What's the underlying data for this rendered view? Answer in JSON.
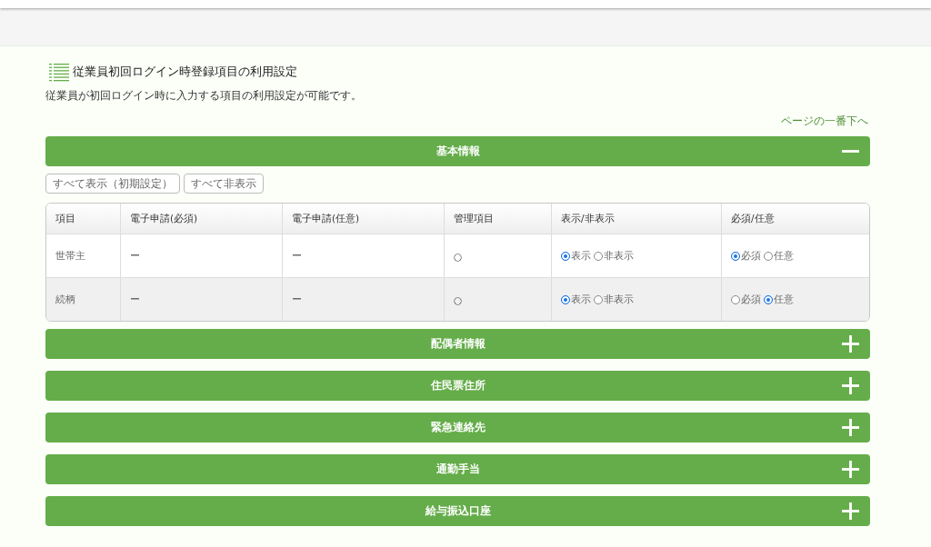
{
  "page": {
    "title": "従業員初回ログイン時登録項目の利用設定",
    "description": "従業員が初回ログイン時に入力する項目の利用設定が可能です。",
    "jump_link": "ページの一番下へ"
  },
  "sections": [
    {
      "title": "基本情報",
      "expanded": true,
      "buttons": [
        "すべて表示（初期設定）",
        "すべて非表示"
      ],
      "table": {
        "columns": [
          "項目",
          "電子申請(必須)",
          "電子申請(任意)",
          "管理項目",
          "表示/非表示",
          "必須/任意"
        ],
        "rows": [
          {
            "item": "世帯主",
            "required_app": "ー",
            "optional_app": "ー",
            "managed": "○",
            "display": [
              {
                "label": "表示",
                "selected": true
              },
              {
                "label": "非表示",
                "selected": false
              }
            ],
            "requirement": [
              {
                "label": "必須",
                "selected": true
              },
              {
                "label": "任意",
                "selected": false
              }
            ]
          },
          {
            "item": "続柄",
            "required_app": "ー",
            "optional_app": "ー",
            "managed": "○",
            "display": [
              {
                "label": "表示",
                "selected": true
              },
              {
                "label": "非表示",
                "selected": false
              }
            ],
            "requirement": [
              {
                "label": "必須",
                "selected": false
              },
              {
                "label": "任意",
                "selected": true
              }
            ]
          }
        ]
      }
    },
    {
      "title": "配偶者情報",
      "expanded": false
    },
    {
      "title": "住民票住所",
      "expanded": false
    },
    {
      "title": "緊急連絡先",
      "expanded": false
    },
    {
      "title": "通勤手当",
      "expanded": false
    },
    {
      "title": "給与振込口座",
      "expanded": false
    }
  ]
}
